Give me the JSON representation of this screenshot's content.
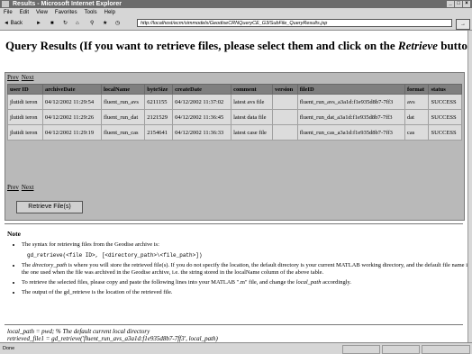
{
  "window": {
    "title": "Results - Microsoft Internet Explorer"
  },
  "menu": {
    "items": [
      "File",
      "Edit",
      "View",
      "Favorites",
      "Tools",
      "Help"
    ]
  },
  "toolbar": {
    "back_label": "Back",
    "address_value": "http://localhost/ecm/simmodels/GeodiseCRNQueryCE_G3/SubFile_QueryResults.jsp"
  },
  "page": {
    "heading_pre": "Query Results (If you want to retrieve files, please select them and click on the ",
    "heading_em": "Retrieve",
    "heading_post": " button).",
    "prev_label": "Prev",
    "next_label": "Next",
    "retrieve_button_label": "Retrieve File(s)"
  },
  "table": {
    "columns": [
      "user ID",
      "archiveDate",
      "localName",
      "byteSize",
      "createDate",
      "comment",
      "version",
      "fileID",
      "format",
      "status"
    ],
    "rows": [
      {
        "user": "jlutidi ieron",
        "archive_date": "04/12/2002 11:29:54",
        "local_name": "fluent_run_avs",
        "byte_size": "6211155",
        "create_date": "04/12/2002 11:37:02",
        "comment": "latest avs file",
        "file_id": "fluent_run_avs_a3a1d:f1e935d8b7-7ff3",
        "format": "avs",
        "status": "SUCCESS"
      },
      {
        "user": "jlutidi ieron",
        "archive_date": "04/12/2002 11:29:26",
        "local_name": "fluent_run_dat",
        "byte_size": "2121529",
        "create_date": "04/12/2002 11:36:45",
        "comment": "latest data file",
        "file_id": "fluent_run_dat_a3a1d:f1e935d8b7-7ff3",
        "format": "dat",
        "status": "SUCCESS"
      },
      {
        "user": "jlutidi ieron",
        "archive_date": "04/12/2002 11:29:19",
        "local_name": "fluent_run_cas",
        "byte_size": "2154641",
        "create_date": "04/12/2002 11:36:33",
        "comment": "latest case file",
        "file_id": "fluent_run_cas_a3a1d:f1e935d8b7-7ff3",
        "format": "cas",
        "status": "SUCCESS"
      }
    ]
  },
  "notes": {
    "heading": "Note",
    "item1": "The syntax for retrieving files from the Geodise archive is:",
    "item1_code": "gd_retrieve(<file ID>, [<directory_path>\\<file_path>])",
    "item2_pre": "The ",
    "item2_em": "directory_path",
    "item2_post": " is where you will store the retrieved file(s). If you do not specify the location, the default directory is your current MATLAB working directory, and the default file name is the one used when the file was archived in the Geodise archive, i.e. the string stored in the localName column of the above table.",
    "item3_pre": "To retrieve the selected files, please copy and paste the following lines into your MATLAB \".m\" file, and change the ",
    "item3_em": "local_path",
    "item3_post": " accordingly.",
    "item4": "The output of the gd_retrieve is the location of the retrieved file."
  },
  "code": {
    "line1": "local_path = pwd; % The default current local directory",
    "line2": "retrieved_file1 = gd_retrieve('fluent_run_avs_a3a1d:f1e935d8b7-7ff3', local_path)"
  },
  "status": {
    "text": "Done"
  }
}
